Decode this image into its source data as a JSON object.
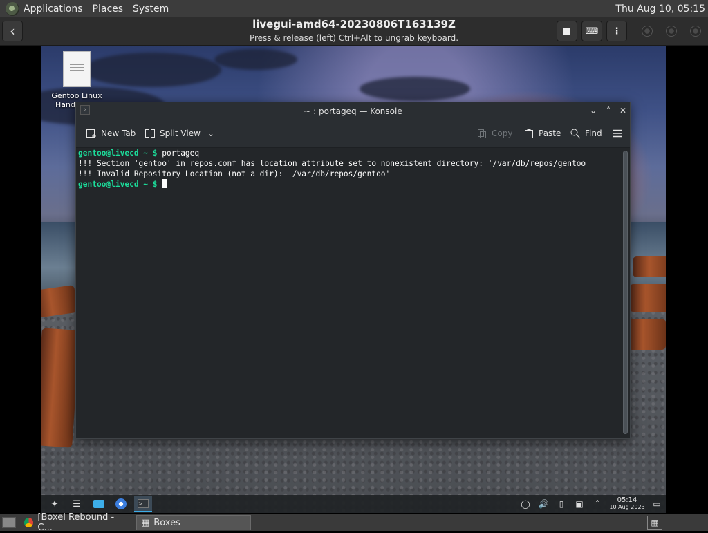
{
  "host_panel": {
    "menus": [
      "Applications",
      "Places",
      "System"
    ],
    "clock": "Thu Aug 10, 05:15"
  },
  "boxes_header": {
    "title": "livegui-amd64-20230806T163139Z",
    "subtitle": "Press & release (left) Ctrl+Alt to ungrab keyboard."
  },
  "desktop": {
    "file_label_line1": "Gentoo Linux",
    "file_label_line2": "Hand"
  },
  "konsole": {
    "title": "~ : portageq — Konsole",
    "toolbar": {
      "new_tab": "New Tab",
      "split_view": "Split View",
      "copy": "Copy",
      "paste": "Paste",
      "find": "Find"
    },
    "terminal": {
      "prompt": "gentoo@livecd ~ $",
      "command": " portageq",
      "output_line1": "!!! Section 'gentoo' in repos.conf has location attribute set to nonexistent directory: '/var/db/repos/gentoo'",
      "output_line2": "!!! Invalid Repository Location (not a dir): '/var/db/repos/gentoo'",
      "prompt2": "gentoo@livecd ~ $"
    }
  },
  "guest_taskbar": {
    "time": "05:14",
    "date": "10 Aug 2023"
  },
  "host_bottom": {
    "task1": "[Boxel Rebound - C...",
    "task2": "Boxes"
  }
}
